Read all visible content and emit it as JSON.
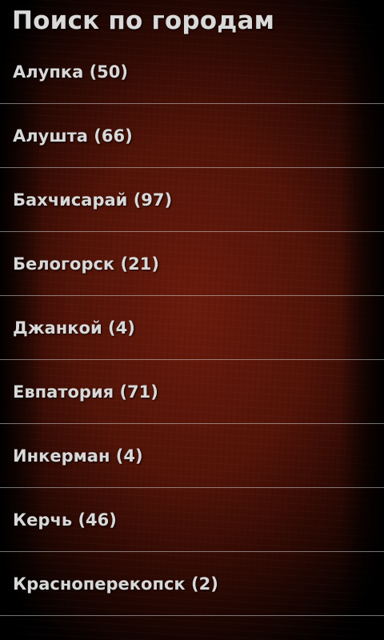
{
  "header": {
    "title": "Поиск по городам"
  },
  "cities": [
    {
      "label": "Алупка (50)"
    },
    {
      "label": "Алушта (66)"
    },
    {
      "label": "Бахчисарай (97)"
    },
    {
      "label": "Белогорск (21)"
    },
    {
      "label": "Джанкой (4)"
    },
    {
      "label": "Евпатория (71)"
    },
    {
      "label": "Инкерман (4)"
    },
    {
      "label": "Керчь (46)"
    },
    {
      "label": "Красноперекопск (2)"
    }
  ],
  "colors": {
    "background": "#5a1408",
    "text": "#d8d8d8",
    "divider": "#d2d2d2"
  }
}
